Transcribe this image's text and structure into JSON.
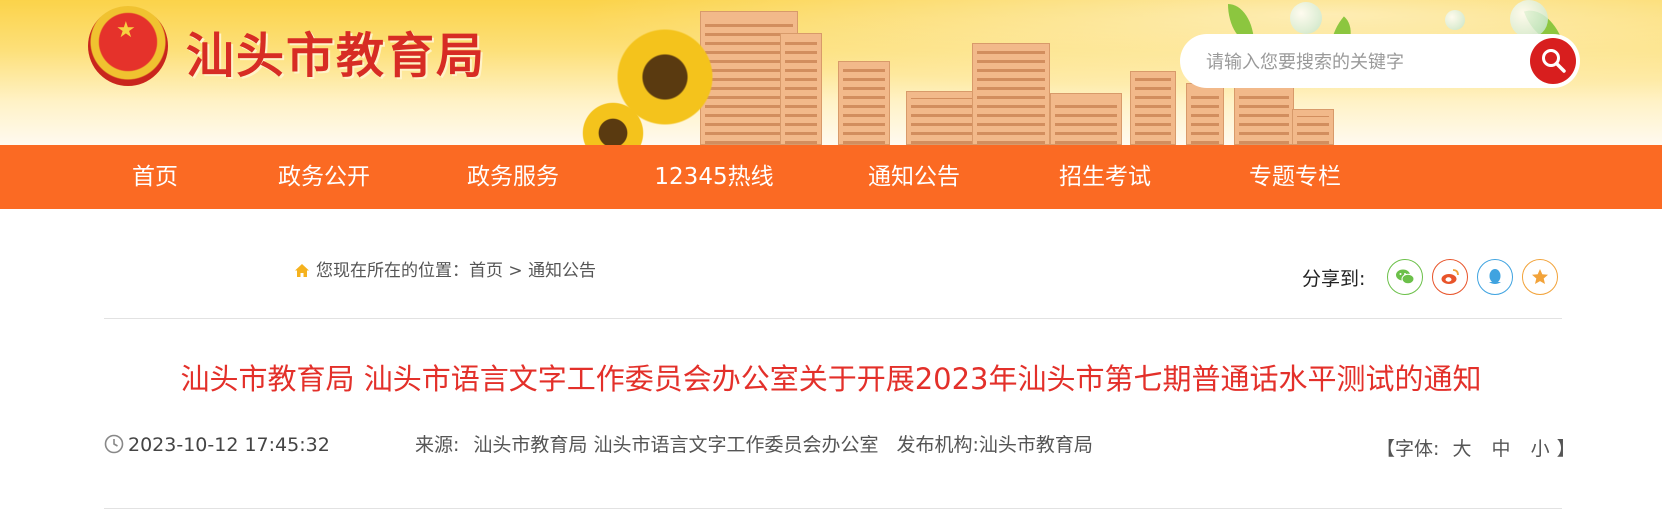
{
  "header": {
    "site_title": "汕头市教育局",
    "search": {
      "placeholder": "请输入您要搜索的关键字"
    }
  },
  "nav": {
    "items": [
      {
        "label": "首页"
      },
      {
        "label": "政务公开"
      },
      {
        "label": "政务服务"
      },
      {
        "label": "12345热线"
      },
      {
        "label": "通知公告"
      },
      {
        "label": "招生考试"
      },
      {
        "label": "专题专栏"
      }
    ]
  },
  "breadcrumb": {
    "prefix": "您现在所在的位置：",
    "home": "首页",
    "separator": ">",
    "current": "通知公告"
  },
  "share": {
    "label": "分享到:",
    "targets": [
      "wechat-icon",
      "weibo-icon",
      "qq-icon",
      "favorite-icon"
    ],
    "colors": {
      "wechat": "#6cc04a",
      "weibo": "#e8542a",
      "qq": "#3fa3e0",
      "favorite": "#f2a33a"
    }
  },
  "article": {
    "title": "汕头市教育局 汕头市语言文字工作委员会办公室关于开展2023年汕头市第七期普通话水平测试的通知",
    "datetime": "2023-10-12 17:45:32",
    "source_label": "来源:",
    "source": "汕头市教育局 汕头市语言文字工作委员会办公室",
    "publisher_label": "发布机构:",
    "publisher": "汕头市教育局",
    "font_size": {
      "label": "【字体:",
      "large": "大",
      "medium": "中",
      "small": "小",
      "close": "】"
    }
  },
  "colors": {
    "nav_bg": "#fb6a23",
    "title_red": "#e3302a",
    "site_title_red": "#d72c24"
  }
}
